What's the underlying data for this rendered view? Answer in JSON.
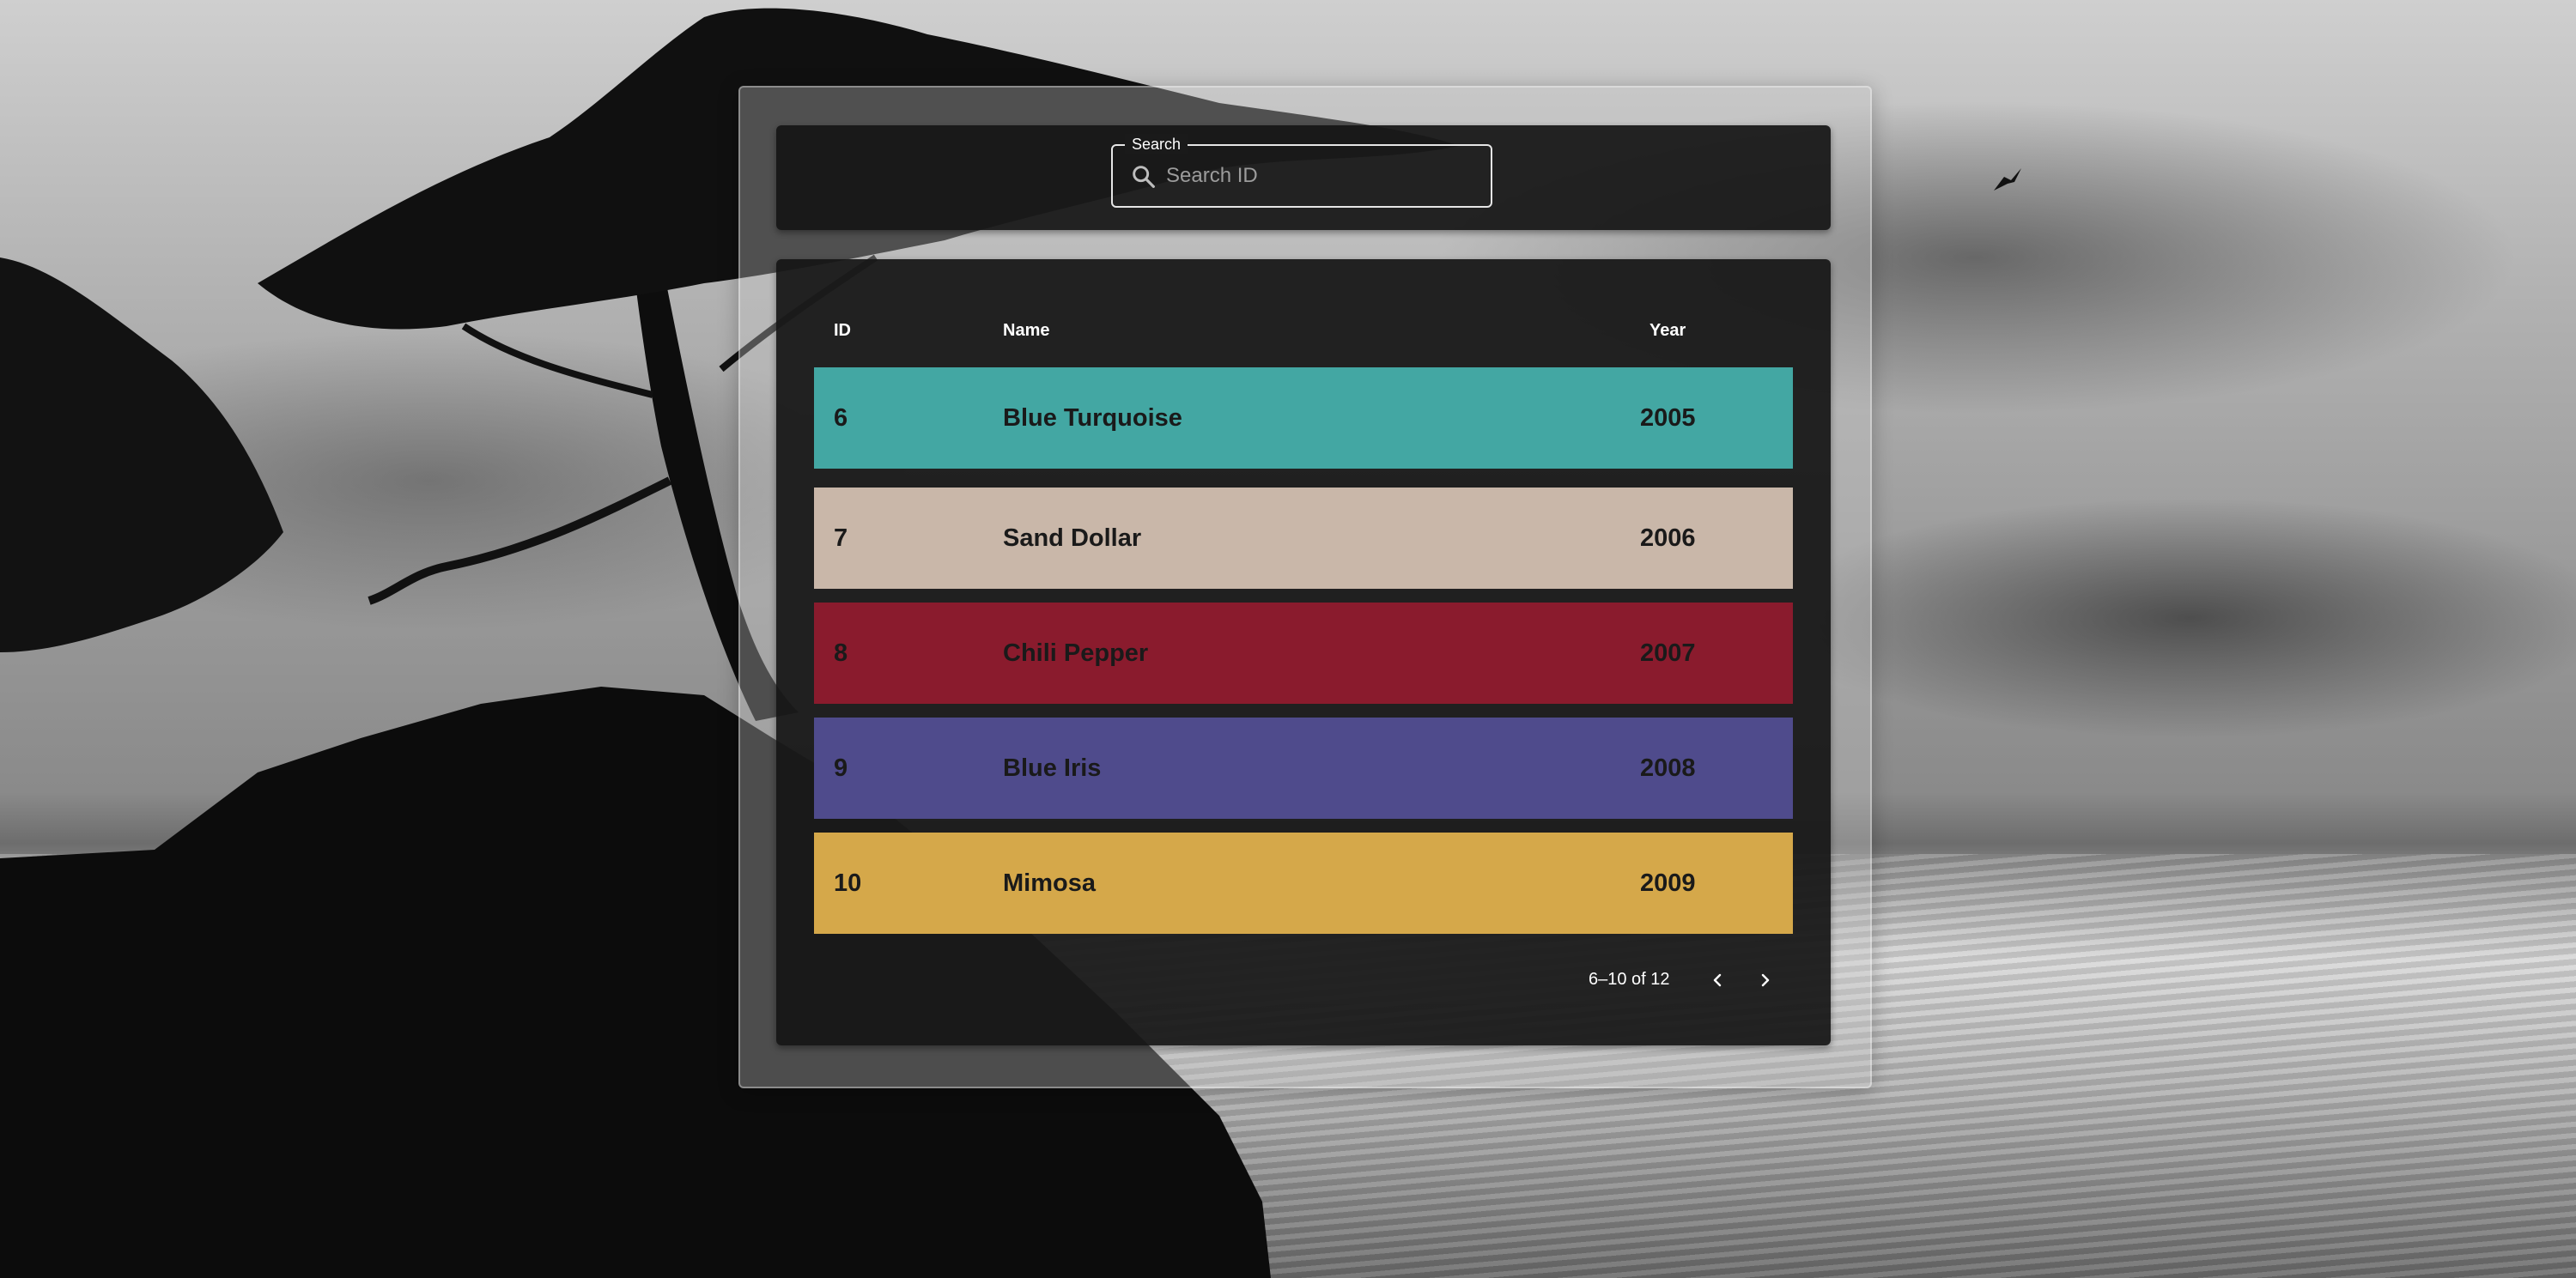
{
  "search": {
    "legend": "Search",
    "placeholder": "Search ID",
    "value": ""
  },
  "table": {
    "headers": {
      "id": "ID",
      "name": "Name",
      "year": "Year"
    },
    "rows": [
      {
        "id": "6",
        "name": "Blue Turquoise",
        "year": "2005",
        "color": "#43A7A3"
      },
      {
        "id": "7",
        "name": "Sand Dollar",
        "year": "2006",
        "color": "#C9B7A9"
      },
      {
        "id": "8",
        "name": "Chili Pepper",
        "year": "2007",
        "color": "#8A1B2D"
      },
      {
        "id": "9",
        "name": "Blue Iris",
        "year": "2008",
        "color": "#4F4B8C"
      },
      {
        "id": "10",
        "name": "Mimosa",
        "year": "2009",
        "color": "#D5A84A"
      }
    ]
  },
  "pagination": {
    "range_text": "6–10 of 12",
    "prev_icon": "chevron-left-icon",
    "next_icon": "chevron-right-icon"
  }
}
